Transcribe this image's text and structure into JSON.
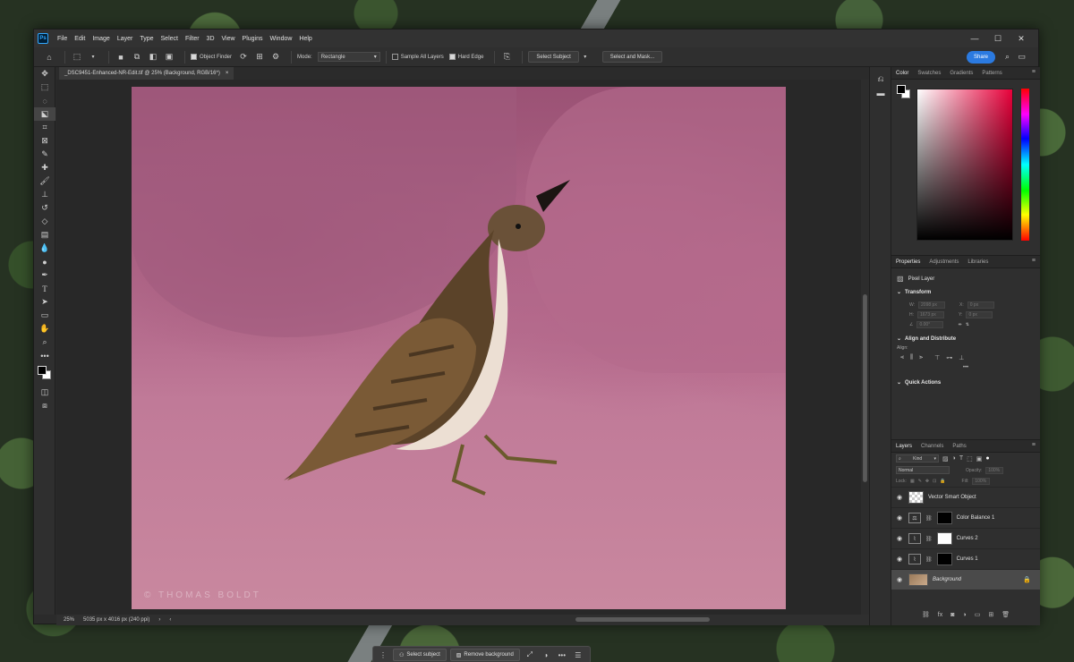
{
  "app": {
    "logo": "Ps",
    "menu": [
      "File",
      "Edit",
      "Image",
      "Layer",
      "Type",
      "Select",
      "Filter",
      "3D",
      "View",
      "Plugins",
      "Window",
      "Help"
    ],
    "window_controls": [
      "—",
      "☐",
      "✕"
    ]
  },
  "options_bar": {
    "object_finder": "Object Finder",
    "mode_label": "Mode:",
    "mode_value": "Rectangle",
    "sample_all_layers": "Sample All Layers",
    "hard_edge": "Hard Edge",
    "select_subject": "Select Subject",
    "select_and_mask": "Select and Mask...",
    "share": "Share"
  },
  "document": {
    "tab_title": "_DSC9451-Enhanced-NR-Edit.tif @ 25% (Background, RGB/16*)",
    "tab_close": "×",
    "watermark": "© THOMAS BOLDT"
  },
  "contextual_bar": {
    "select_subject": "Select subject",
    "remove_background": "Remove background"
  },
  "status": {
    "zoom": "25%",
    "dimensions": "5035 px x 4016 px (240 ppi)"
  },
  "color_panel": {
    "tabs": [
      "Color",
      "Swatches",
      "Gradients",
      "Patterns"
    ],
    "active_tab": "Color",
    "foreground": "#000000",
    "background": "#ffffff"
  },
  "properties_panel": {
    "tabs": [
      "Properties",
      "Adjustments",
      "Libraries"
    ],
    "layer_kind": "Pixel Layer",
    "transform": "Transform",
    "w_label": "W:",
    "w_value": "2098 px",
    "h_label": "H:",
    "h_value": "1673 px",
    "x_label": "X:",
    "x_value": "0 px",
    "y_label": "Y:",
    "y_value": "0 px",
    "angle_value": "0.00°",
    "align_distribute": "Align and Distribute",
    "align_label": "Align:",
    "more": "•••",
    "quick_actions": "Quick Actions"
  },
  "layers_panel": {
    "tabs": [
      "Layers",
      "Channels",
      "Paths"
    ],
    "kind": "Kind",
    "blend_mode": "Normal",
    "opacity_label": "Opacity:",
    "opacity_value": "100%",
    "lock_label": "Lock:",
    "fill_label": "Fill:",
    "fill_value": "100%",
    "layers": [
      {
        "name": "Vector Smart Object",
        "type": "smart"
      },
      {
        "name": "Color Balance 1",
        "type": "adjustment"
      },
      {
        "name": "Curves 2",
        "type": "curves-white"
      },
      {
        "name": "Curves 1",
        "type": "curves"
      },
      {
        "name": "Background",
        "type": "background"
      }
    ]
  }
}
